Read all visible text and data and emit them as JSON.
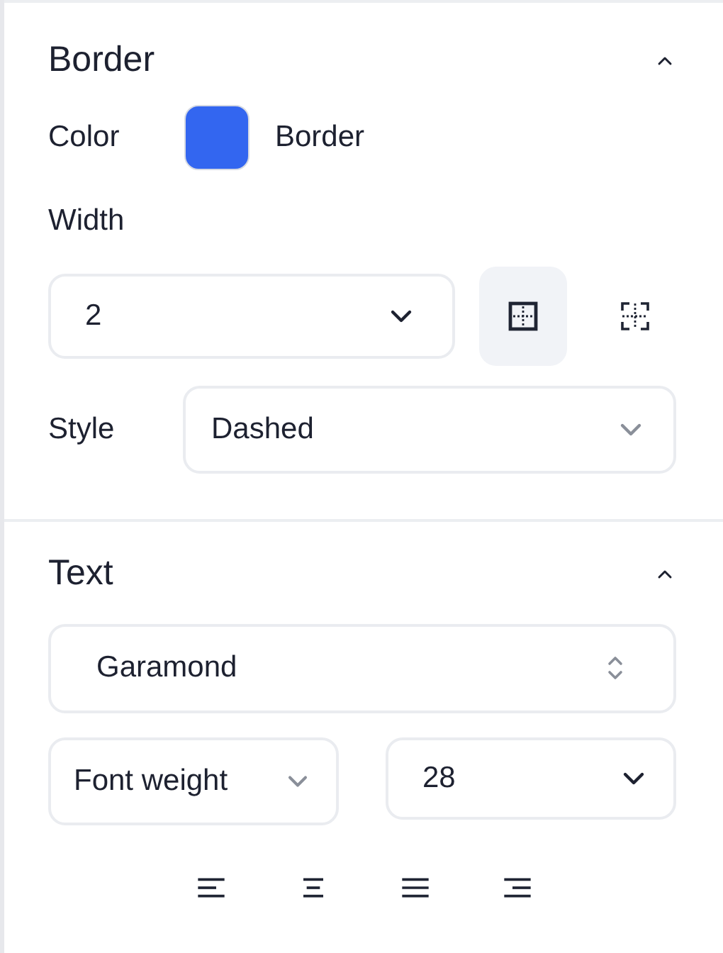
{
  "border": {
    "title": "Border",
    "expanded": true,
    "color_label": "Color",
    "color": "#3366f0",
    "color_name": "Border",
    "width_label": "Width",
    "width_value": "2",
    "width_modes": [
      {
        "kind": "outer",
        "selected": true
      },
      {
        "kind": "inner",
        "selected": false
      }
    ],
    "style_label": "Style",
    "style_value": "Dashed"
  },
  "text": {
    "title": "Text",
    "expanded": true,
    "font": "Garamond",
    "font_weight": "Font weight",
    "font_size": "28",
    "alignments": [
      {
        "kind": "left",
        "selected": false
      },
      {
        "kind": "center",
        "selected": false
      },
      {
        "kind": "justify",
        "selected": false
      },
      {
        "kind": "right",
        "selected": false
      }
    ]
  }
}
